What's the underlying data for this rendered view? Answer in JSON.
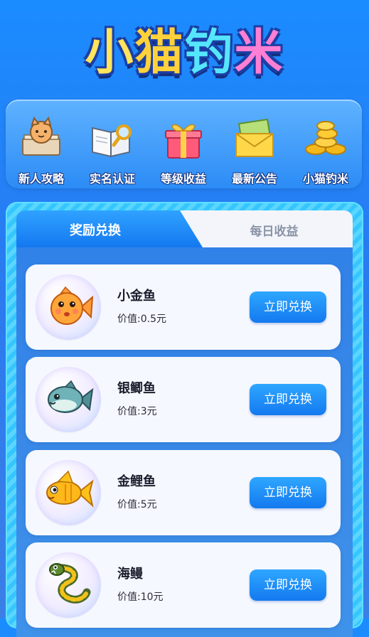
{
  "logo": {
    "title_chars": [
      "小",
      "猫",
      "钓",
      "米"
    ]
  },
  "menu": {
    "items": [
      {
        "label": "新人攻略",
        "icon": "cat-guidebook-icon"
      },
      {
        "label": "实名认证",
        "icon": "book-magnifier-icon"
      },
      {
        "label": "等级收益",
        "icon": "gift-box-icon"
      },
      {
        "label": "最新公告",
        "icon": "envelope-icon"
      },
      {
        "label": "小猫钓米",
        "icon": "gold-coins-icon"
      }
    ]
  },
  "tabs": {
    "active": "奖励兑换",
    "inactive": "每日收益"
  },
  "rewards": [
    {
      "name": "小金鱼",
      "value": "价值:0.5元",
      "button": "立即兑换",
      "icon": "goldfish-icon"
    },
    {
      "name": "银鲫鱼",
      "value": "价值:3元",
      "button": "立即兑换",
      "icon": "silver-carp-icon"
    },
    {
      "name": "金鲤鱼",
      "value": "价值:5元",
      "button": "立即兑换",
      "icon": "golden-carp-icon"
    },
    {
      "name": "海鳗",
      "value": "价值:10元",
      "button": "立即兑换",
      "icon": "eel-icon"
    }
  ],
  "colors": {
    "accent": "#1479f0",
    "background": "#1a8cff",
    "panel_stripe": "#35c6ff"
  }
}
